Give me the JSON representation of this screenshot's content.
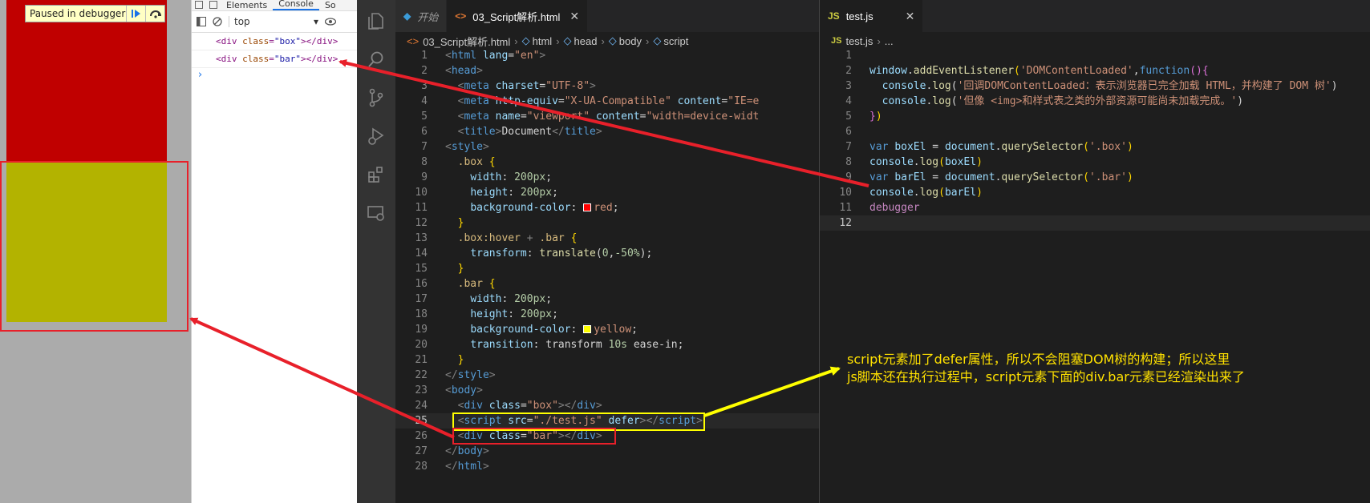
{
  "browser": {
    "paused_label": "Paused in debugger"
  },
  "devtools": {
    "tabs": [
      "Elements",
      "Console",
      "So"
    ],
    "context": "top",
    "console_lines": [
      {
        "open": "<div",
        "attr": "class",
        "value": "\"box\"",
        "close": "></div>"
      },
      {
        "open": "<div",
        "attr": "class",
        "value": "\"bar\"",
        "close": "></div>"
      }
    ],
    "prompt": "›"
  },
  "editor_left": {
    "tabs": [
      {
        "icon": "vscode-icon",
        "label": "开始",
        "active": false
      },
      {
        "icon": "html-icon",
        "label": "03_Script解析.html",
        "active": true
      }
    ],
    "more": "···",
    "breadcrumb": [
      "03_Script解析.html",
      "html",
      "head",
      "body",
      "script"
    ],
    "current_line": 25
  },
  "editor_right": {
    "tab": {
      "icon": "JS",
      "label": "test.js"
    },
    "breadcrumb": [
      "test.js",
      "..."
    ],
    "current_line": 12
  },
  "annotation": {
    "line1": "script元素加了defer属性，所以不会阻塞DOM树的构建；所以这里",
    "line2": "js脚本还在执行过程中，script元素下面的div.bar元素已经渲染出来了"
  },
  "colors": {
    "red_box": "#c00000",
    "yellow_box": "#b3b300",
    "arrow_red": "#e8202a",
    "arrow_yellow": "#ffff00"
  }
}
